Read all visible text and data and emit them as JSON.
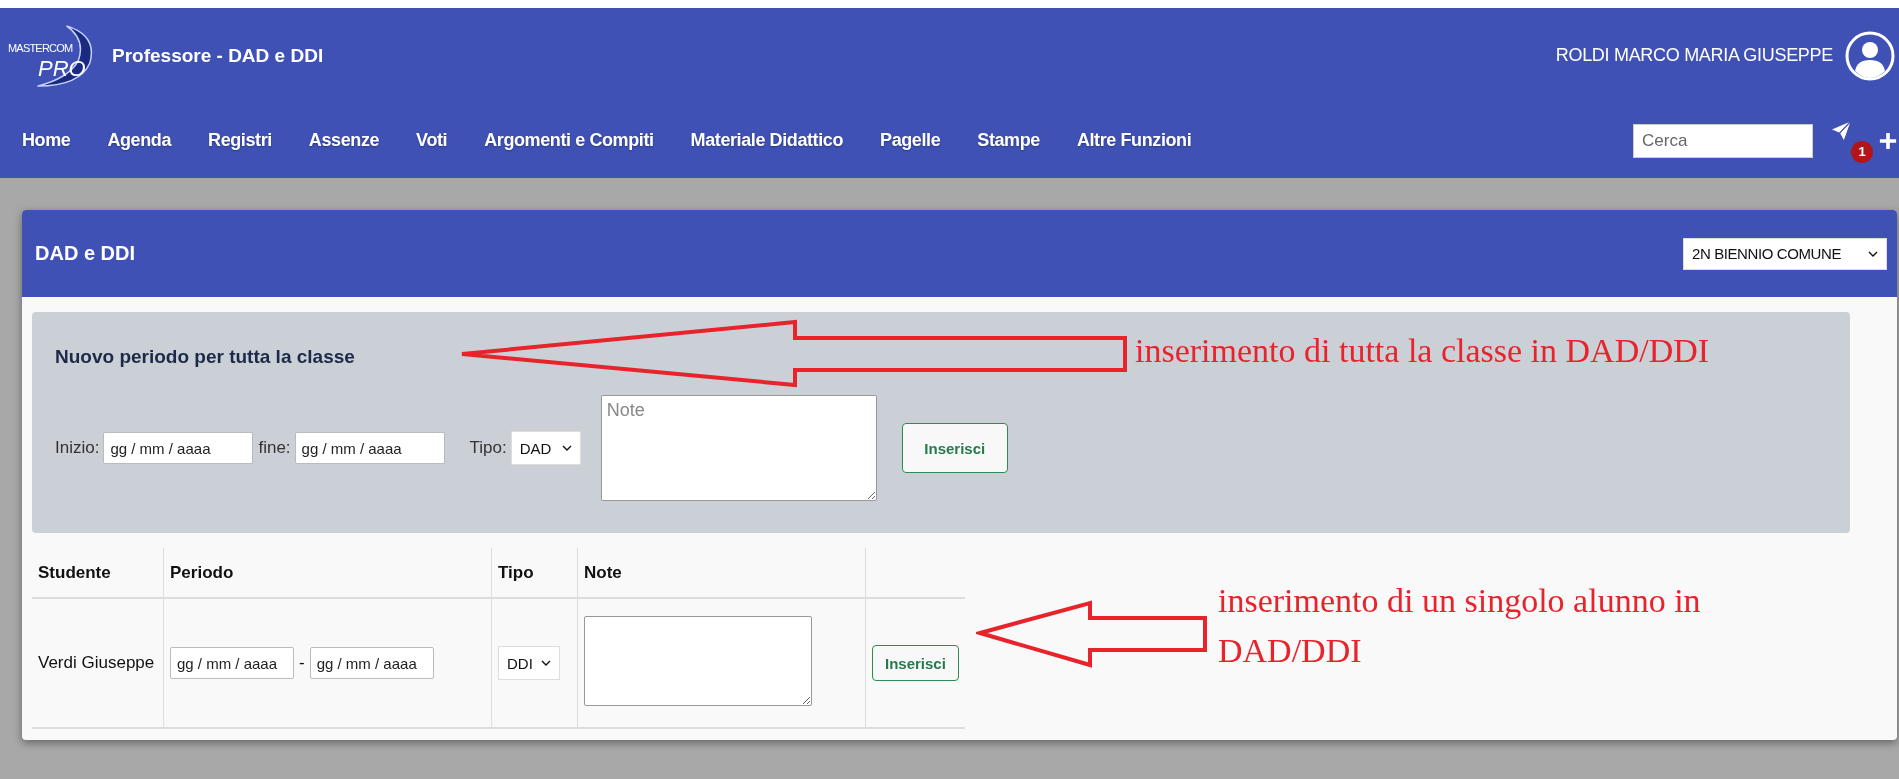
{
  "header": {
    "logo": {
      "line1": "MASTERCOM",
      "line2": "PRO"
    },
    "title": "Professore - DAD e DDI",
    "user": "ROLDI MARCO MARIA GIUSEPPE"
  },
  "nav": {
    "items": [
      "Home",
      "Agenda",
      "Registri",
      "Assenze",
      "Voti",
      "Argomenti e Compiti",
      "Materiale Didattico",
      "Pagelle",
      "Stampe",
      "Altre Funzioni"
    ],
    "search": {
      "placeholder": "Cerca"
    },
    "notification_count": "1"
  },
  "card": {
    "title": "DAD e DDI",
    "class_select": "2N BIENNIO COMUNE",
    "class_form": {
      "title": "Nuovo periodo per tutta la classe",
      "start_label": "Inizio:",
      "start": {
        "placeholder": "gg / mm / aaaa"
      },
      "end_label": "fine:",
      "end": {
        "placeholder": "gg / mm / aaaa"
      },
      "type_label": "Tipo:",
      "type": "DAD",
      "note": {
        "placeholder": "Note"
      },
      "button": "Inserisci"
    },
    "table": {
      "columns": [
        "Studente",
        "Periodo",
        "Tipo",
        "Note"
      ],
      "rows": [
        {
          "student": "Verdi Giuseppe",
          "start": {
            "placeholder": "gg / mm / aaaa"
          },
          "separator": "-",
          "end": {
            "placeholder": "gg / mm / aaaa"
          },
          "type": "DDI",
          "button": "Inserisci"
        }
      ]
    }
  },
  "annotations": [
    {
      "text": "inserimento di tutta la classe in DAD/DDI"
    },
    {
      "text": "inserimento di un singolo alunno in DAD/DDI"
    }
  ]
}
